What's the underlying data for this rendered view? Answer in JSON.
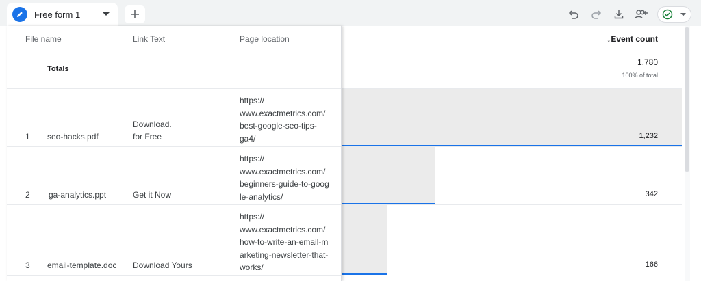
{
  "tab": {
    "label": "Free form 1",
    "icon": "pencil-icon"
  },
  "toolbar": {
    "icons": [
      "undo-icon",
      "redo-icon",
      "download-icon",
      "share-user-icon",
      "check-circle-icon",
      "caret-down-icon"
    ]
  },
  "table": {
    "headers": {
      "file_name": "File name",
      "link_text": "Link Text",
      "page_location": "Page location",
      "event_count": "↓Event count"
    },
    "totals": {
      "label": "Totals",
      "value": "1,780",
      "percent": "100% of total"
    },
    "rows": [
      {
        "index": "1",
        "file_name": "seo-hacks.pdf",
        "link_text": [
          "Download.",
          "for Free"
        ],
        "page_location": [
          "https://",
          "www.exactmetrics.com/",
          "best-google-seo-tips-",
          "ga4/"
        ],
        "event_count": "1,232",
        "event_value": 1232
      },
      {
        "index": "2",
        "file_name": "ga-analytics.ppt",
        "link_text": [
          "Get it Now"
        ],
        "page_location": [
          "https://",
          "www.exactmetrics.com/",
          "beginners-guide-to-goog",
          "le-analytics/"
        ],
        "event_count": "342",
        "event_value": 342
      },
      {
        "index": "3",
        "file_name": "email-template.doc",
        "link_text": [
          "Download Yours"
        ],
        "page_location": [
          "https://",
          "www.exactmetrics.com/",
          "how-to-write-an-email-m",
          "arketing-newsletter-that-",
          "works/"
        ],
        "event_count": "166",
        "event_value": 166
      }
    ]
  },
  "colors": {
    "accent": "#1a73e8",
    "bar_fill": "#ebebeb",
    "tab_bar": "#f1f3f4",
    "status_ok": "#188038"
  }
}
